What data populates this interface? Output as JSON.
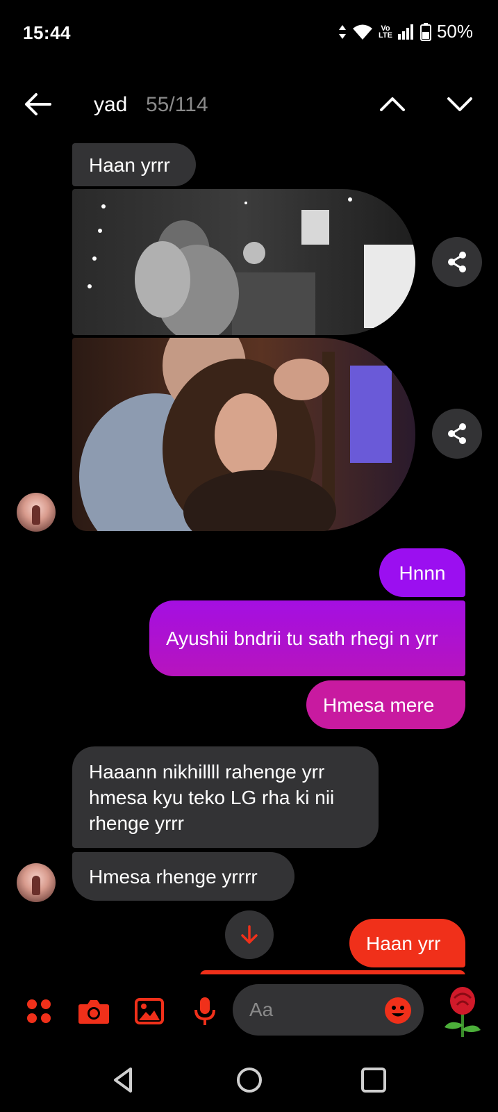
{
  "status_bar": {
    "time": "15:44",
    "volte": "Vo\nLTE",
    "battery": "50%"
  },
  "header": {
    "title": "yad",
    "match_count": "55/114"
  },
  "messages": [
    {
      "side": "in",
      "text": "Haan yrrr"
    },
    {
      "side": "in",
      "type": "gif"
    },
    {
      "side": "in",
      "type": "gif"
    },
    {
      "side": "out",
      "text": "Hnnn"
    },
    {
      "side": "out",
      "text": "Ayushii bndrii tu sath rhegi n yrr"
    },
    {
      "side": "out",
      "text": "Hmesa mere"
    },
    {
      "side": "in",
      "text": "Haaann nikhillll rahenge yrr hmesa kyu teko LG rha ki nii rhenge yrrr"
    },
    {
      "side": "in",
      "text": "Hmesa rhenge yrrrr"
    },
    {
      "side": "out",
      "text": "Haan yrr"
    }
  ],
  "composer": {
    "placeholder": "Aa"
  },
  "colors": {
    "accent": "#f0301a",
    "incoming_bubble": "#333335",
    "outgoing_top": "#9b0ff0",
    "outgoing_bottom": "#c81aa0",
    "outgoing_last": "#f0301a"
  }
}
